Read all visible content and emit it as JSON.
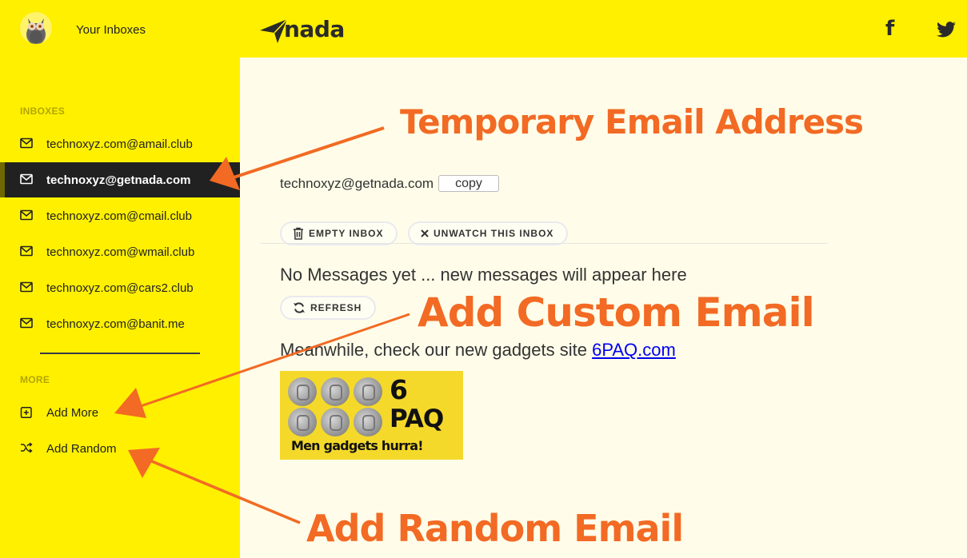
{
  "header": {
    "your_inboxes": "Your Inboxes",
    "logo_text": "nada",
    "social": {
      "facebook": "f",
      "twitter": "twitter-icon"
    }
  },
  "sidebar": {
    "inboxes_label": "INBOXES",
    "inboxes": [
      {
        "label": "technoxyz.com@amail.club",
        "icon": "mail-icon",
        "active": false
      },
      {
        "label": "technoxyz@getnada.com",
        "icon": "mail-icon",
        "active": true
      },
      {
        "label": "technoxyz.com@cmail.club",
        "icon": "mail-icon",
        "active": false
      },
      {
        "label": "technoxyz.com@wmail.club",
        "icon": "mail-icon",
        "active": false
      },
      {
        "label": "technoxyz.com@cars2.club",
        "icon": "mail-icon",
        "active": false
      },
      {
        "label": "technoxyz.com@banit.me",
        "icon": "mail-icon",
        "active": false
      }
    ],
    "more_label": "MORE",
    "more": [
      {
        "label": "Add More",
        "icon": "plus-square-icon"
      },
      {
        "label": "Add Random",
        "icon": "shuffle-icon"
      }
    ]
  },
  "main": {
    "current_email": "technoxyz@getnada.com",
    "copy_label": "copy",
    "empty_inbox_label": "EMPTY INBOX",
    "unwatch_label": "UNWATCH THIS INBOX",
    "no_messages": "No Messages yet ... new messages will appear here",
    "refresh_label": "REFRESH",
    "meanwhile_text": "Meanwhile, check our new gadgets site ",
    "meanwhile_link": "6PAQ.com",
    "ad": {
      "line1": "6",
      "line2": "PAQ",
      "tagline": "Men gadgets hurra!"
    }
  },
  "annotations": {
    "temporary": "Temporary Email Address",
    "custom": "Add Custom Email",
    "random": "Add Random Email"
  },
  "colors": {
    "brand_yellow": "#fff000",
    "annotation_orange": "#f26a24",
    "active_row": "#212121",
    "content_bg": "#fffde9"
  }
}
